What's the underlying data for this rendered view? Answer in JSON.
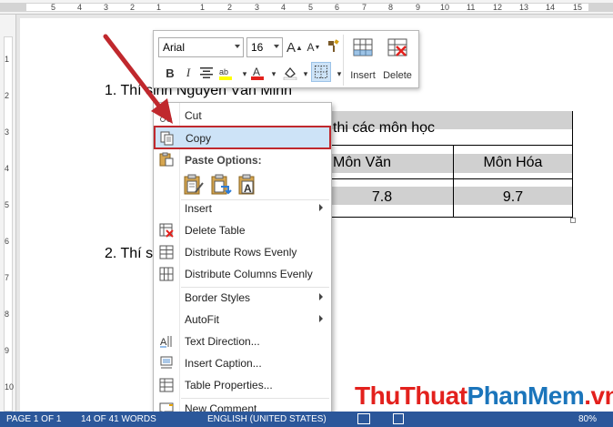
{
  "ruler": {
    "horizontal_numbers": [
      "5",
      "4",
      "3",
      "2",
      "1",
      "1",
      "2",
      "3",
      "4",
      "5",
      "6",
      "7",
      "8",
      "9",
      "10",
      "11",
      "12",
      "13",
      "14",
      "15"
    ],
    "vertical_numbers": [
      "1",
      "2",
      "3",
      "4",
      "5",
      "6",
      "7",
      "8",
      "9",
      "10"
    ]
  },
  "document": {
    "line1": "1. Thí sinh Nguyễn Văn Minh",
    "line2": "2. Thí s",
    "table": {
      "header_text": "thi các môn học",
      "columns": [
        "Môn Văn",
        "Môn Hóa"
      ],
      "values": [
        "7.8",
        "9.7"
      ]
    }
  },
  "mini_toolbar": {
    "font_name": "Arial",
    "font_size": "16",
    "insert_label": "Insert",
    "delete_label": "Delete",
    "bold": "B",
    "italic": "I"
  },
  "context_menu": {
    "items": [
      {
        "label": "Cut",
        "icon": "scissors-icon"
      },
      {
        "label": "Copy",
        "icon": "copy-icon",
        "highlighted": true
      },
      {
        "label": "Paste Options:",
        "icon": "clipboard-icon"
      },
      {
        "label": "Insert",
        "icon": "",
        "submenu": true
      },
      {
        "label": "Delete Table",
        "icon": "delete-table-icon"
      },
      {
        "label": "Distribute Rows Evenly",
        "icon": "distribute-rows-icon"
      },
      {
        "label": "Distribute Columns Evenly",
        "icon": "distribute-columns-icon"
      },
      {
        "label": "Border Styles",
        "icon": "",
        "submenu": true
      },
      {
        "label": "AutoFit",
        "icon": "",
        "submenu": true
      },
      {
        "label": "Text Direction...",
        "icon": "text-direction-icon"
      },
      {
        "label": "Insert Caption...",
        "icon": "caption-icon"
      },
      {
        "label": "Table Properties...",
        "icon": "table-properties-icon"
      },
      {
        "label": "New Comment",
        "icon": "new-comment-icon"
      }
    ]
  },
  "status_bar": {
    "page": "PAGE 1 OF 1",
    "words": "14 OF 41 WORDS",
    "language": "ENGLISH (UNITED STATES)",
    "zoom": "80%"
  },
  "watermark": {
    "part1": "ThuThuat",
    "part2": "PhanMem",
    "part3": ".vn"
  },
  "colors": {
    "accent": "#2b579a",
    "highlight": "#cde3f7",
    "red_outline": "#c0282d",
    "arrow": "#c0282d"
  }
}
